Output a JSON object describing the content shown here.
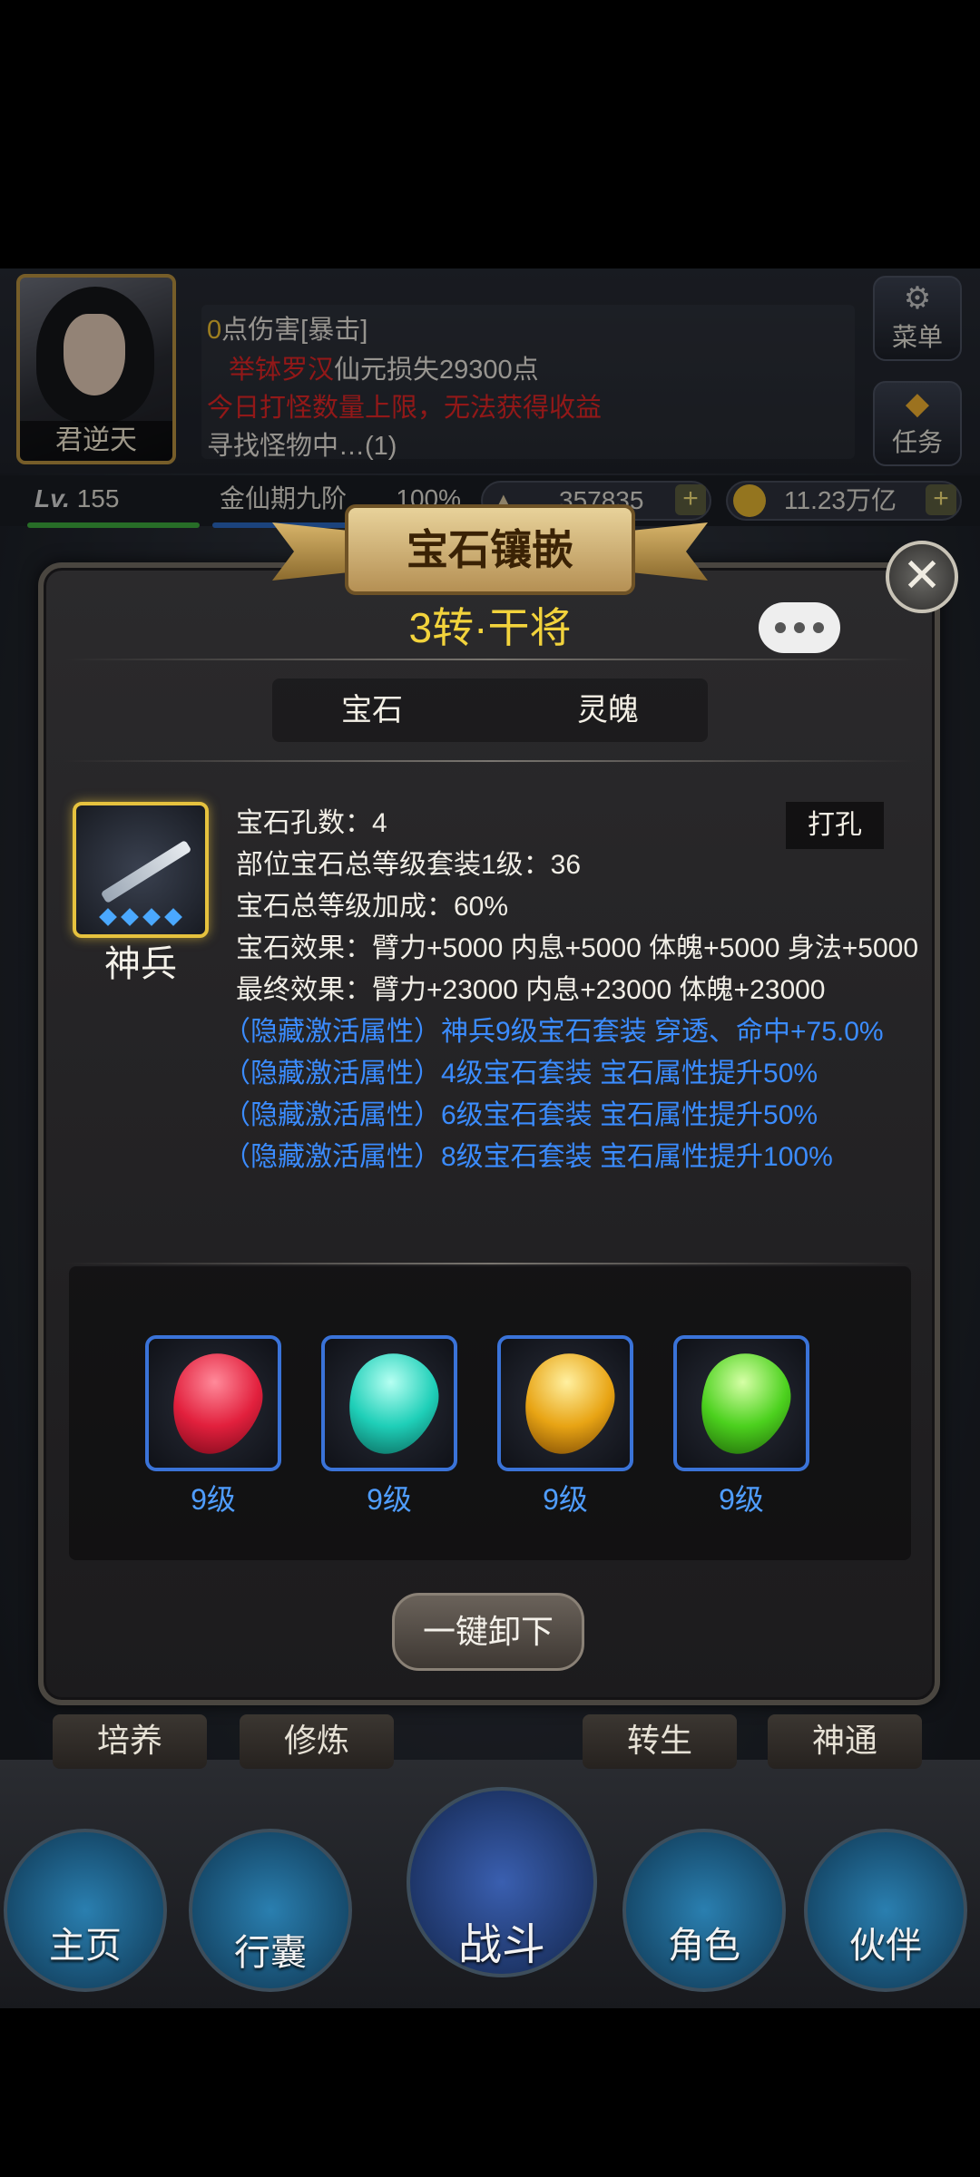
{
  "hud": {
    "character_name": "君逆天",
    "log_lines": [
      {
        "prefix": "0",
        "text": "点伤害[暴击]"
      },
      {
        "red": "举钵罗汉",
        "text": "仙元损失29300点"
      },
      {
        "red": "今日打怪数量上限，无法获得收益"
      },
      {
        "text": "寻找怪物中…(1)"
      }
    ],
    "menu_label": "菜单",
    "task_label": "任务",
    "level_label": "Lv.",
    "level_value": "155",
    "realm_label": "金仙期九阶",
    "realm_progress_text": "100%",
    "realm_progress": 1.0,
    "ingot_value": "357835",
    "gold_value": "11.23万亿",
    "plus_symbol": "+"
  },
  "dialog": {
    "banner_title": "宝石镶嵌",
    "title": "3转·干将",
    "close_symbol": "✕",
    "tabs": [
      "宝石",
      "灵魄"
    ],
    "equipment_name": "神兵",
    "punch_button": "打孔",
    "info_lines": [
      "宝石孔数：4",
      "部位宝石总等级套装1级：36",
      "宝石总等级加成：60%",
      "宝石效果：臂力+5000 内息+5000 体魄+5000 身法+5000",
      "最终效果：臂力+23000 内息+23000 体魄+23000"
    ],
    "hidden_lines": [
      "（隐藏激活属性）神兵9级宝石套装 穿透、命中+75.0%",
      "（隐藏激活属性）4级宝石套装 宝石属性提升50%",
      "（隐藏激活属性）6级宝石套装 宝石属性提升50%",
      "（隐藏激活属性）8级宝石套装 宝石属性提升100%"
    ],
    "gems": [
      {
        "level": "9级",
        "color": "#e2203d"
      },
      {
        "level": "9级",
        "color": "#1fcfb8"
      },
      {
        "level": "9级",
        "color": "#e8a414"
      },
      {
        "level": "9级",
        "color": "#4cd11e"
      }
    ],
    "unload_button": "一键卸下"
  },
  "subnav": [
    "培养",
    "修炼",
    "转生",
    "神通"
  ],
  "bottom_nav": [
    "主页",
    "行囊",
    "战斗",
    "角色",
    "伙伴"
  ]
}
